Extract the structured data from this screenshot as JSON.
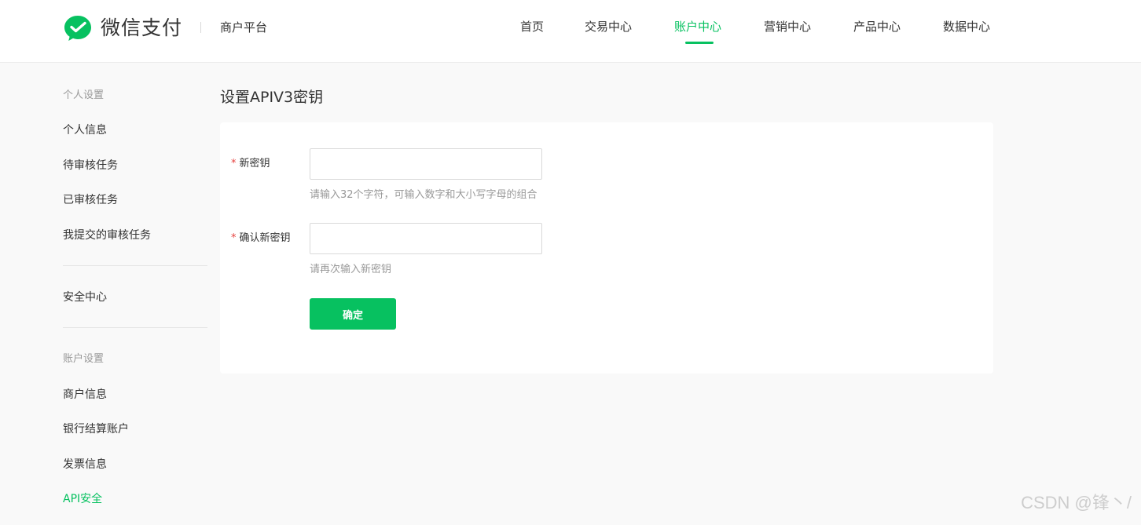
{
  "header": {
    "brand_name": "微信支付",
    "platform_name": "商户平台",
    "nav": [
      {
        "label": "首页",
        "active": false
      },
      {
        "label": "交易中心",
        "active": false
      },
      {
        "label": "账户中心",
        "active": true
      },
      {
        "label": "营销中心",
        "active": false
      },
      {
        "label": "产品中心",
        "active": false
      },
      {
        "label": "数据中心",
        "active": false
      }
    ]
  },
  "sidebar": {
    "section_personal": "个人设置",
    "personal_items": [
      "个人信息",
      "待审核任务",
      "已审核任务",
      "我提交的审核任务"
    ],
    "security_center": "安全中心",
    "section_account": "账户设置",
    "account_items": [
      "商户信息",
      "银行结算账户",
      "发票信息",
      "API安全"
    ],
    "active_item": "API安全"
  },
  "main": {
    "title": "设置APIV3密钥",
    "form": {
      "new_key_label": "新密钥",
      "new_key_value": "",
      "new_key_hint": "请输入32个字符，可输入数字和大小写字母的组合",
      "confirm_key_label": "确认新密钥",
      "confirm_key_value": "",
      "confirm_key_hint": "请再次输入新密钥",
      "required_mark": "*",
      "submit_label": "确定"
    }
  },
  "watermark": "CSDN @锋丶/",
  "colors": {
    "accent": "#07c160",
    "required": "#e64340",
    "background": "#f9f9f9",
    "hint": "#999999"
  },
  "icons": {
    "brand_logo": "wechat-pay-logo-icon"
  }
}
